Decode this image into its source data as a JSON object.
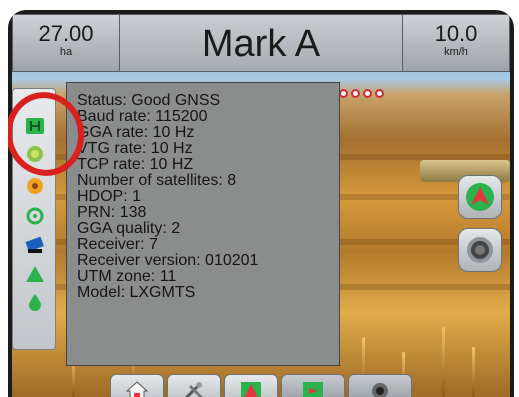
{
  "colors": {
    "highlight": "#d8201f",
    "panel_bg": "#8b8c8c",
    "bar_bg": "#b3b7bc",
    "accent_green": "#2bb24c",
    "accent_red": "#e3353b"
  },
  "top_bar": {
    "area": {
      "value": "27.00",
      "unit": "ha"
    },
    "title": "Mark A",
    "speed": {
      "value": "10.0",
      "unit": "km/h"
    }
  },
  "info_panel": {
    "lines": [
      "Status: Good GNSS",
      "Baud rate:  115200",
      "GGA rate: 10 Hz",
      "VTG rate: 10 Hz",
      "TCP rate: 10 HZ",
      "Number of satellites: 8",
      "HDOP: 1",
      "PRN: 138",
      "GGA quality: 2",
      "Receiver: 7",
      "Receiver version: 010201",
      "UTM zone: 11",
      "Model: LXGMTS"
    ]
  },
  "left_toolbar": {
    "icons": [
      "gnss-status-icon",
      "rate-icon",
      "section-status-icon",
      "steering-icon",
      "tilt-icon",
      "guidance-icon",
      "water-drop-icon"
    ]
  },
  "right_buttons": [
    "guidance-arrow-icon",
    "camera-lens-icon"
  ],
  "bottom_tabs": [
    "home-icon",
    "tools-icon",
    "field-map-icon",
    "guidance-screen-icon",
    "camera-icon"
  ]
}
